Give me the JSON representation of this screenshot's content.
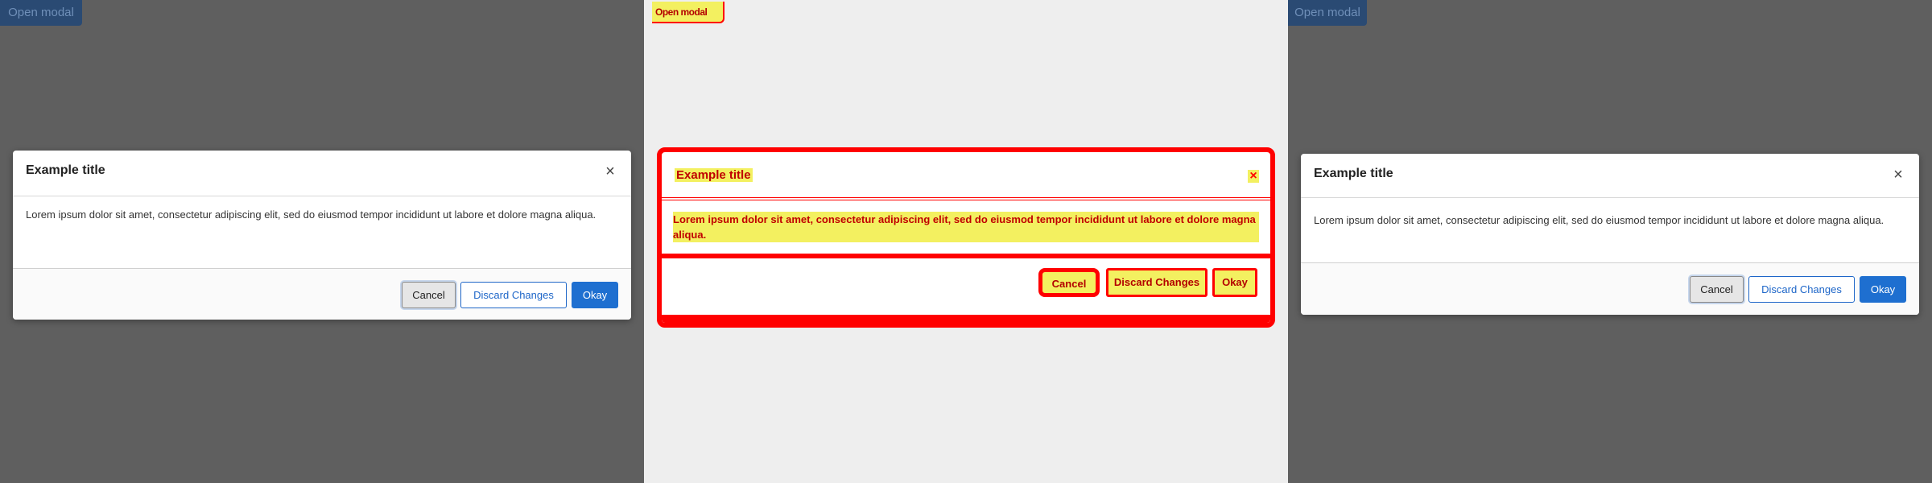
{
  "open_modal_label": "Open modal",
  "modal": {
    "title": "Example title",
    "close_symbol": "×",
    "body": "Lorem ipsum dolor sit amet, consectetur adipiscing elit, sed do eiusmod tempor incididunt ut labore et dolore magna aliqua.",
    "buttons": {
      "cancel": "Cancel",
      "discard": "Discard Changes",
      "okay": "Okay"
    }
  },
  "colors": {
    "backdrop": "#5f5f5f",
    "primary": "#1e6fd0",
    "diff_highlight": "#ff0000",
    "diff_fill": "#f3f060"
  }
}
